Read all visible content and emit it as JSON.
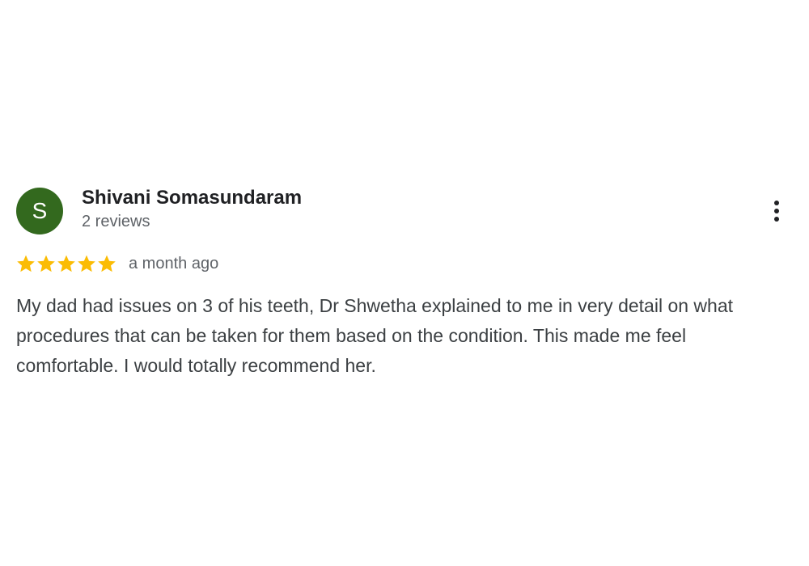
{
  "review": {
    "author": {
      "avatar_letter": "S",
      "avatar_color": "#33691e",
      "name": "Shivani Somasundaram",
      "reviews_count": "2 reviews"
    },
    "more_options_icon": "more-vertical-icon",
    "rating": 5,
    "rating_max": 5,
    "star_color": "#fbbc04",
    "time": "a month ago",
    "text": "My dad had issues on 3 of his teeth, Dr Shwetha explained to me in very detail on what procedures that can be taken for them based on the condition. This made me feel comfortable. I would totally recommend her."
  }
}
